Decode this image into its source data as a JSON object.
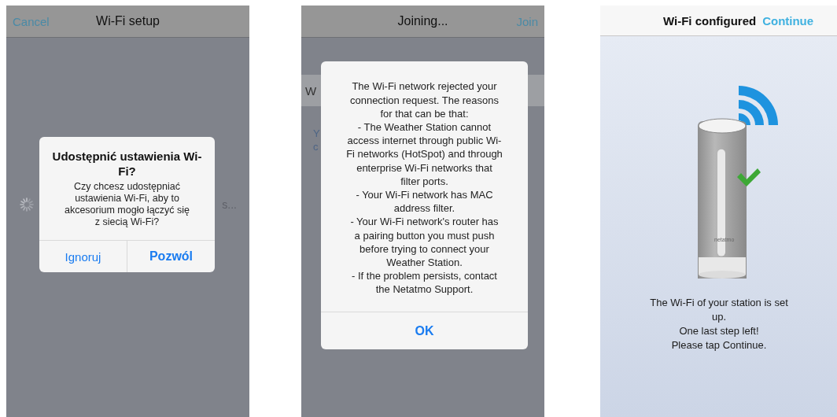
{
  "screens": [
    {
      "kind": "alert",
      "nav": {
        "left": "Cancel",
        "title": "Wi-Fi setup"
      },
      "behind": {
        "kind": "spinner",
        "texts": [
          "s..."
        ]
      },
      "alert": {
        "title_lines": [
          "Udostępnić ustawienia Wi-",
          "Fi?"
        ],
        "message_lines": [
          "Czy chcesz udostępniać",
          "ustawienia Wi-Fi, aby to",
          "akcesorium mogło łączyć się",
          "z siecią Wi-Fi?"
        ],
        "buttons": [
          {
            "label": "Ignoruj",
            "bold": false
          },
          {
            "label": "Pozwól",
            "bold": true
          }
        ]
      }
    },
    {
      "kind": "alert",
      "nav": {
        "title": "Joining...",
        "right": "Join"
      },
      "behind": {
        "kind": "list",
        "texts": [
          "W",
          "Y",
          "c"
        ]
      },
      "alert": {
        "message_lines": [
          "The Wi-Fi network rejected your",
          "connection request. The reasons",
          "for that can be that:",
          "- The Weather Station cannot",
          "access internet through public Wi-",
          "Fi networks (HotSpot) and through",
          "enterprise Wi-Fi networks that",
          "filter ports.",
          "- Your Wi-Fi network has MAC",
          "address filter.",
          "- Your Wi-Fi network's router has",
          "a pairing button you must push",
          "before trying to connect your",
          "Weather Station.",
          "- If the problem persists, contact",
          "the  Netatmo Support."
        ],
        "buttons": [
          {
            "label": "OK",
            "bold": true
          }
        ]
      }
    },
    {
      "kind": "done",
      "nav": {
        "title": "Wi-Fi configured",
        "right": "Continue"
      },
      "device_label": "netatmo",
      "message_lines": [
        "The Wi-Fi of your station is set",
        "up.",
        "One last step left!",
        "Please tap Continue."
      ]
    }
  ]
}
